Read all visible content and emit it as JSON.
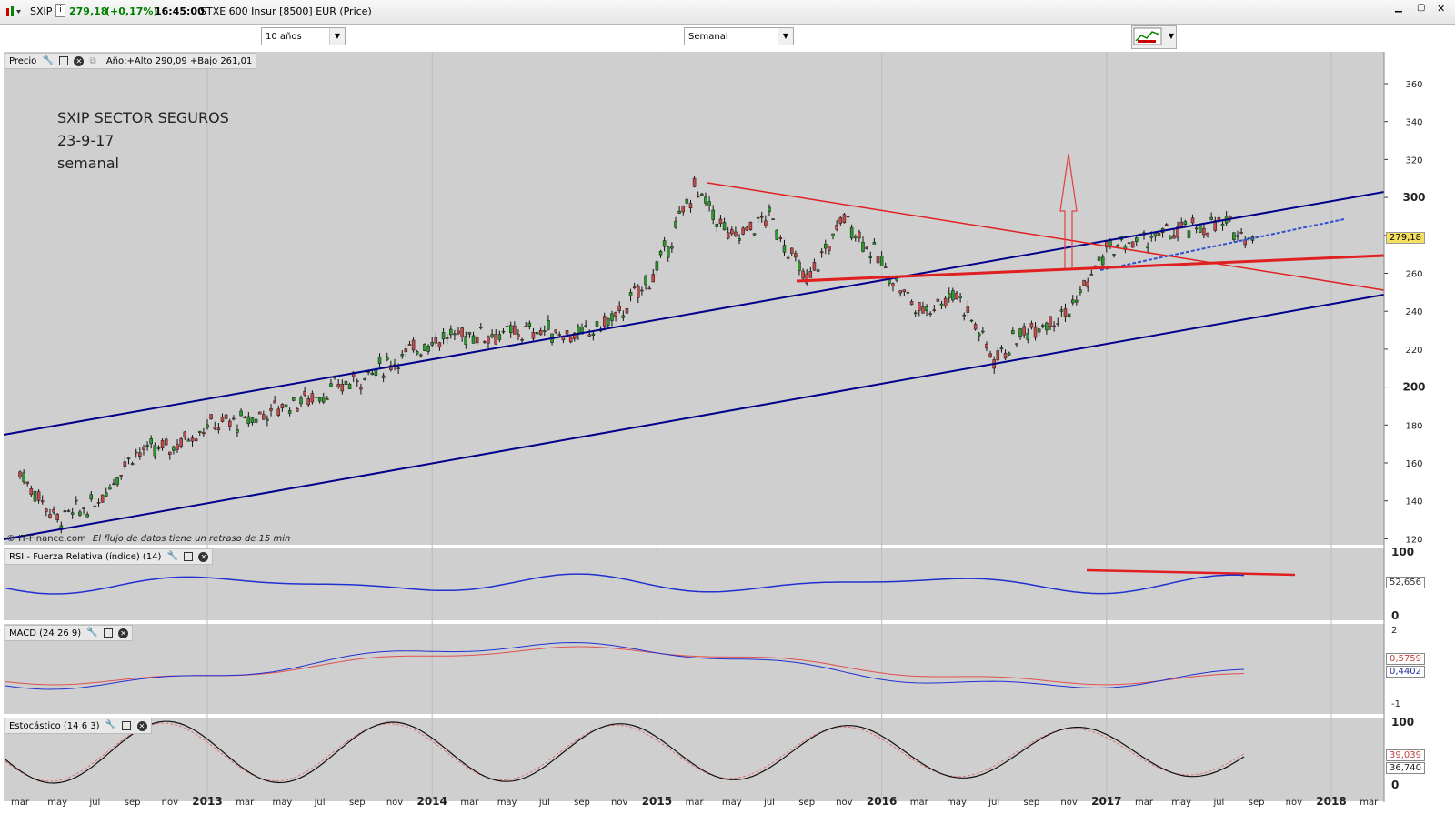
{
  "titlebar": {
    "symbol": "SXIP",
    "info_icon": "i",
    "price": "279,18",
    "change": "(+0,17%)",
    "time": "16:45:00",
    "instrument": "STXE 600 Insur [8500] EUR (Price)"
  },
  "toolbar": {
    "period_value": "10 años",
    "interval_value": "Semanal"
  },
  "panes": {
    "price": {
      "label": "Precio",
      "year_stats": "Año:+Alto 290,09 +Bajo 261,01",
      "last_price": "279,18",
      "y_ticks": [
        "360",
        "340",
        "320",
        "300",
        "280",
        "260",
        "240",
        "220",
        "200",
        "180",
        "160",
        "140",
        "120"
      ]
    },
    "rsi": {
      "label": "RSI - Fuerza Relativa (índice) (14)",
      "value": "52,656",
      "y_ticks": [
        "100",
        "0"
      ]
    },
    "macd": {
      "label": "MACD (24 26 9)",
      "value1": "0,5759",
      "value2": "0,4402",
      "y_ticks": [
        "2",
        "-1"
      ]
    },
    "stoch": {
      "label": "Estocástico (14 6 3)",
      "value1": "39,039",
      "value2": "36,740",
      "y_ticks": [
        "100",
        "0"
      ]
    }
  },
  "annotation": {
    "line1": "SXIP SECTOR SEGUROS",
    "line2": "23-9-17",
    "line3": "semanal"
  },
  "footer_note": {
    "source": "© IT-Finance.com",
    "delay": "El flujo de datos tiene un retraso de 15 min"
  },
  "x_axis": [
    "mar",
    "may",
    "jul",
    "sep",
    "nov",
    "2013",
    "mar",
    "may",
    "jul",
    "sep",
    "nov",
    "2014",
    "mar",
    "may",
    "jul",
    "sep",
    "nov",
    "2015",
    "mar",
    "may",
    "jul",
    "sep",
    "nov",
    "2016",
    "mar",
    "may",
    "jul",
    "sep",
    "nov",
    "2017",
    "mar",
    "may",
    "jul",
    "sep",
    "nov",
    "2018",
    "mar"
  ],
  "colors": {
    "accent_green": "#008000",
    "channel": "#00008b",
    "trend": "#e02020",
    "price_bg": "#cfcfcf"
  },
  "chart_data": {
    "type": "line",
    "title": "",
    "series": [
      {
        "x": [
          "2012-03",
          "2012-05",
          "2012-07",
          "2012-09",
          "2012-11",
          "2013-01",
          "2013-03",
          "2013-05",
          "2013-07",
          "2013-09",
          "2013-11",
          "2014-01",
          "2014-03",
          "2014-05",
          "2014-07",
          "2014-09",
          "2014-11",
          "2015-01",
          "2015-03",
          "2015-05",
          "2015-07",
          "2015-09",
          "2015-11",
          "2016-01",
          "2016-03",
          "2016-05",
          "2016-07",
          "2016-09",
          "2016-11",
          "2017-01",
          "2017-03",
          "2017-05",
          "2017-07",
          "2017-09"
        ],
        "values": [
          155,
          130,
          138,
          165,
          168,
          180,
          182,
          190,
          196,
          204,
          214,
          225,
          228,
          228,
          230,
          227,
          238,
          262,
          305,
          278,
          290,
          255,
          290,
          265,
          240,
          250,
          215,
          232,
          240,
          272,
          278,
          282,
          286,
          279
        ]
      }
    ],
    "ylim": [
      115,
      372
    ]
  }
}
